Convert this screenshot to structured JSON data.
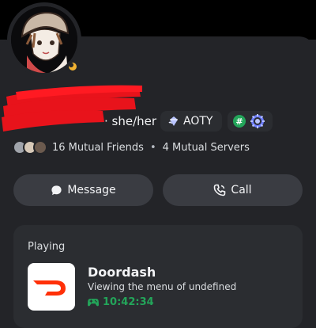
{
  "profile": {
    "pronouns": "· she/her",
    "badge_label": "AOTY"
  },
  "mutuals": {
    "friends": "16 Mutual Friends",
    "separator": "•",
    "servers": "4 Mutual Servers"
  },
  "actions": {
    "message_label": "Message",
    "call_label": "Call"
  },
  "activity": {
    "heading": "Playing",
    "app_name": "Doordash",
    "details": "Viewing the menu of undefined",
    "elapsed": "10:42:34"
  },
  "colors": {
    "status_idle": "#f0b232",
    "elapsed_green": "#23a55a",
    "doordash_red": "#ff3008",
    "redaction_red": "#e8131b"
  },
  "icons": [
    "avatar",
    "idle-status-icon",
    "nitro-gem-icon",
    "hashtag-icon",
    "server-boost-icon",
    "message-icon",
    "phone-icon",
    "doordash-logo",
    "controller-icon"
  ]
}
